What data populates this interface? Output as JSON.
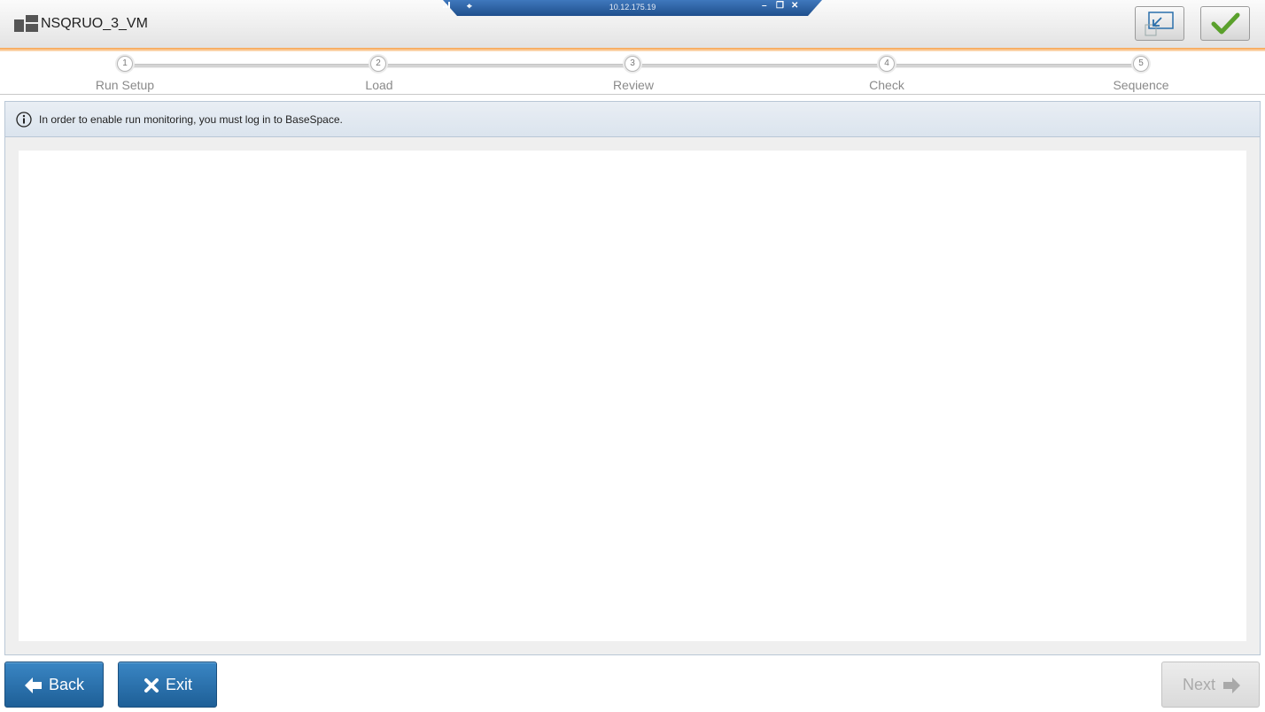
{
  "header": {
    "title": "NSQRUO_3_VM",
    "app_icon": "window-icon",
    "minimize_view_icon": "restore-down-icon",
    "confirm_icon": "checkmark-icon"
  },
  "rdp_bar": {
    "ip": "10.12.175.19",
    "pin_icon": "pin-icon",
    "signal_icon": "signal-icon",
    "minimize_label": "–",
    "restore_label": "❐",
    "close_label": "✕"
  },
  "stepper": {
    "steps": [
      {
        "number": "1",
        "label": "Run Setup"
      },
      {
        "number": "2",
        "label": "Load"
      },
      {
        "number": "3",
        "label": "Review"
      },
      {
        "number": "4",
        "label": "Check"
      },
      {
        "number": "5",
        "label": "Sequence"
      }
    ]
  },
  "info": {
    "icon": "info-icon",
    "message": "In order to enable run monitoring, you must log in to BaseSpace."
  },
  "footer": {
    "back_label": "Back",
    "exit_label": "Exit",
    "next_label": "Next"
  },
  "colors": {
    "accent_orange": "#f7a14a",
    "primary_blue": "#2a6fab",
    "rdp_blue": "#2b5d9c",
    "check_green": "#5aa02c"
  }
}
